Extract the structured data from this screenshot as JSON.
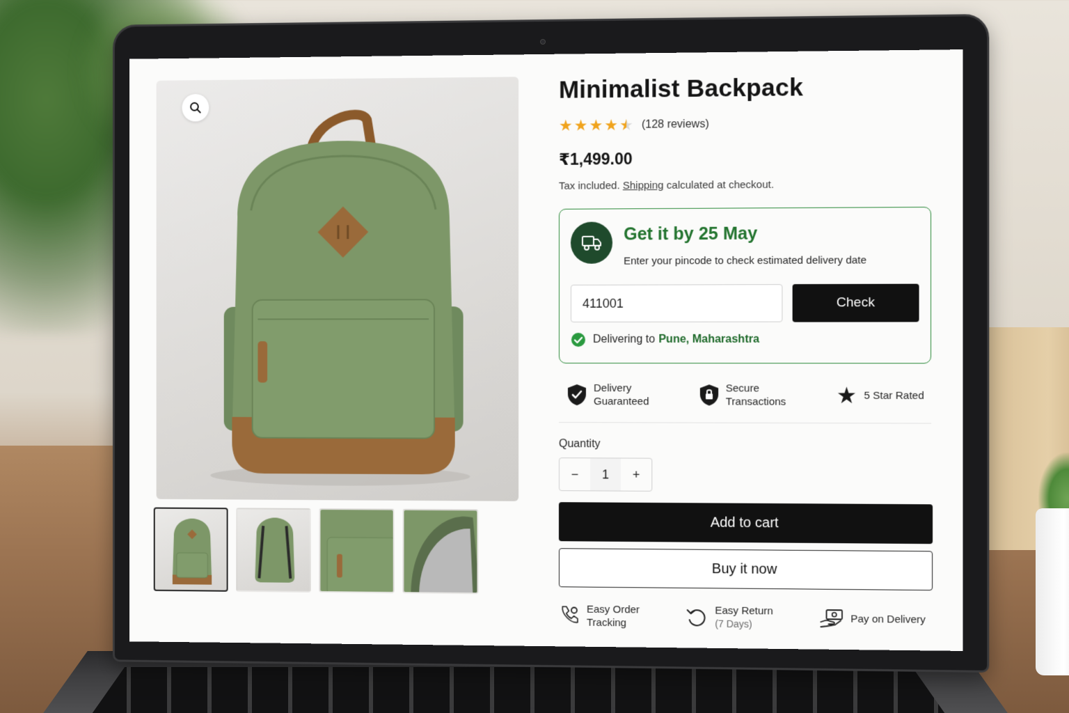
{
  "product": {
    "title": "Minimalist Backpack",
    "rating": 4.5,
    "reviews_label": "(128 reviews)",
    "price": "₹1,499.00",
    "tax_prefix": "Tax included. ",
    "tax_link": "Shipping",
    "tax_suffix": " calculated at checkout."
  },
  "gallery": {
    "thumbnail_count": 4,
    "active_index": 0
  },
  "delivery": {
    "heading": "Get it by 25 May",
    "subtext": "Enter your pincode to check estimated delivery date",
    "pincode_value": "411001",
    "check_label": "Check",
    "status_prefix": "Delivering to",
    "status_city": "Pune, Maharashtra"
  },
  "badges": [
    {
      "line1": "Delivery",
      "line2": "Guaranteed",
      "icon": "shield-check-icon"
    },
    {
      "line1": "Secure",
      "line2": "Transactions",
      "icon": "shield-lock-icon"
    },
    {
      "line1": "5 Star Rated",
      "line2": "",
      "icon": "star-icon"
    }
  ],
  "quantity": {
    "label": "Quantity",
    "value": "1",
    "minus": "−",
    "plus": "+"
  },
  "actions": {
    "add_to_cart": "Add to cart",
    "buy_now": "Buy it now"
  },
  "features": [
    {
      "line1": "Easy Order",
      "line2": "Tracking",
      "icon": "tracking-icon"
    },
    {
      "line1": "Easy Return",
      "line2": "(7 Days)",
      "icon": "return-icon"
    },
    {
      "line1": "Pay on Delivery",
      "line2": "",
      "icon": "cash-icon"
    }
  ],
  "colors": {
    "accent_green": "#23742f",
    "star_gold": "#f0a31c",
    "button_black": "#111111"
  }
}
